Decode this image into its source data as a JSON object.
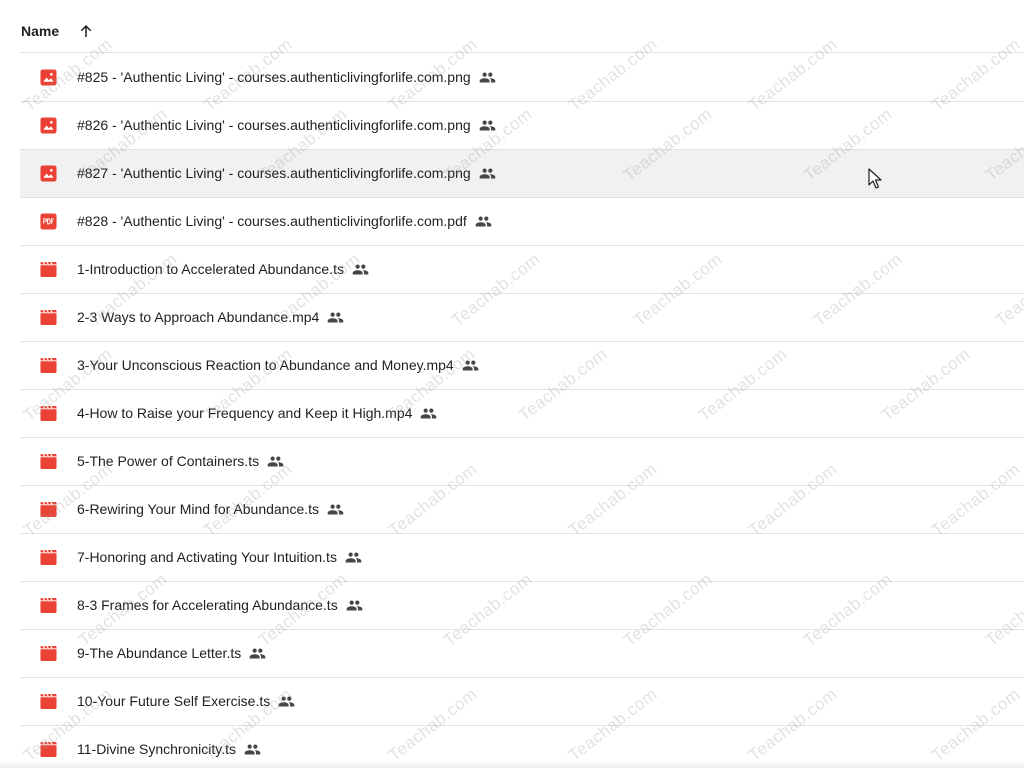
{
  "header": {
    "name_label": "Name",
    "sort_icon": "arrow-up-icon"
  },
  "files": [
    {
      "name": "#825 - 'Authentic Living' - courses.authenticlivingforlife.com.png",
      "type": "image",
      "icon": "image-file-icon",
      "shared": true
    },
    {
      "name": "#826 - 'Authentic Living' - courses.authenticlivingforlife.com.png",
      "type": "image",
      "icon": "image-file-icon",
      "shared": true
    },
    {
      "name": "#827 - 'Authentic Living' - courses.authenticlivingforlife.com.png",
      "type": "image",
      "icon": "image-file-icon",
      "shared": true,
      "hovered": true
    },
    {
      "name": "#828 - 'Authentic Living' - courses.authenticlivingforlife.com.pdf",
      "type": "pdf",
      "icon": "pdf-file-icon",
      "shared": true
    },
    {
      "name": "1-Introduction to Accelerated Abundance.ts",
      "type": "video",
      "icon": "video-file-icon",
      "shared": true
    },
    {
      "name": "2-3 Ways to Approach Abundance.mp4",
      "type": "video",
      "icon": "video-file-icon",
      "shared": true
    },
    {
      "name": "3-Your Unconscious Reaction to Abundance and Money.mp4",
      "type": "video",
      "icon": "video-file-icon",
      "shared": true
    },
    {
      "name": "4-How to Raise your Frequency and Keep it High.mp4",
      "type": "video",
      "icon": "video-file-icon",
      "shared": true
    },
    {
      "name": "5-The Power of Containers.ts",
      "type": "video",
      "icon": "video-file-icon",
      "shared": true
    },
    {
      "name": "6-Rewiring Your Mind for Abundance.ts",
      "type": "video",
      "icon": "video-file-icon",
      "shared": true
    },
    {
      "name": "7-Honoring and Activating Your Intuition.ts",
      "type": "video",
      "icon": "video-file-icon",
      "shared": true
    },
    {
      "name": "8-3 Frames for Accelerating Abundance.ts",
      "type": "video",
      "icon": "video-file-icon",
      "shared": true
    },
    {
      "name": "9-The Abundance Letter.ts",
      "type": "video",
      "icon": "video-file-icon",
      "shared": true
    },
    {
      "name": "10-Your Future Self Exercise.ts",
      "type": "video",
      "icon": "video-file-icon",
      "shared": true
    },
    {
      "name": "11-Divine Synchronicity.ts",
      "type": "video",
      "icon": "video-file-icon",
      "shared": true
    }
  ],
  "watermark_text": "Teachab.com",
  "colors": {
    "file_icon_red": "#ea4335",
    "text": "#1f1f1f",
    "shared_icon": "#444746",
    "divider": "#e1e3e1",
    "hover_row": "#f1f1f1"
  },
  "shared_icon_name": "people-shared-icon"
}
